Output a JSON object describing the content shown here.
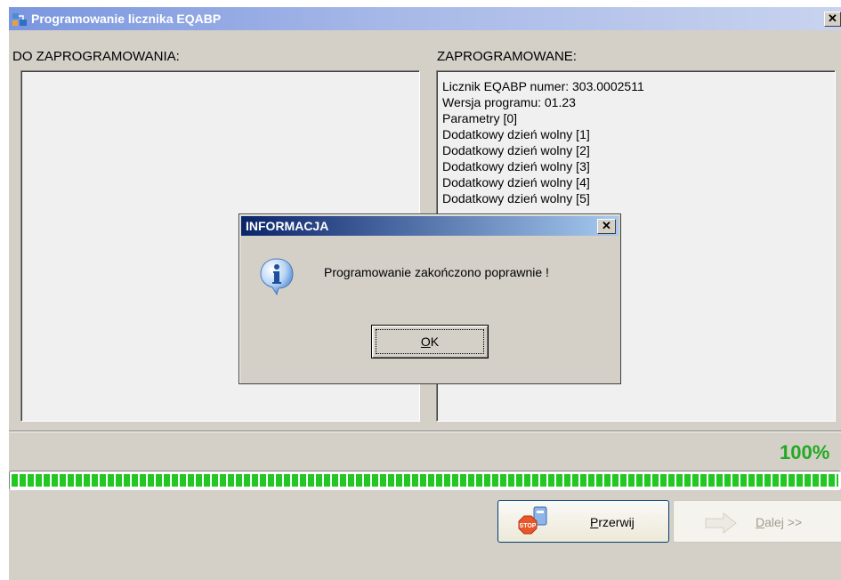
{
  "window": {
    "title": "Programowanie licznika EQABP",
    "close_glyph": "✕",
    "icon": "app-icon"
  },
  "left_panel": {
    "label": "DO ZAPROGRAMOWANIA:",
    "items": []
  },
  "right_panel": {
    "label": "ZAPROGRAMOWANE:",
    "items": [
      "Licznik EQABP numer: 303.0002511",
      "Wersja programu: 01.23",
      "Parametry [0]",
      "Dodatkowy dzień wolny [1]",
      "Dodatkowy dzień wolny [2]",
      "Dodatkowy dzień wolny [3]",
      "Dodatkowy dzień wolny [4]",
      "Dodatkowy dzień wolny [5]"
    ]
  },
  "progress": {
    "label": "100%",
    "value": 100,
    "color": "#22c822"
  },
  "buttons": {
    "stop": {
      "prefix": "P",
      "rest": "rzerwij",
      "icon": "stop-sign-icon"
    },
    "next": {
      "prefix": "D",
      "rest": "alej >>",
      "icon": "arrow-right-icon"
    }
  },
  "dialog": {
    "title": "INFORMACJA",
    "close_glyph": "✕",
    "message": "Programowanie zakończono poprawnie !",
    "ok": {
      "prefix": "O",
      "rest": "K"
    },
    "icon": "info-icon"
  }
}
